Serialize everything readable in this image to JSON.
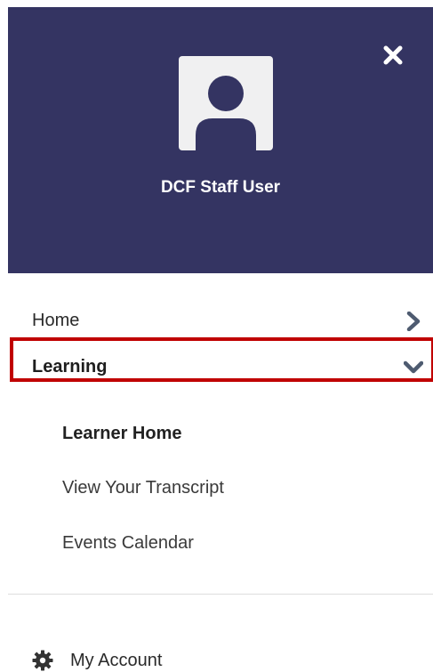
{
  "profile": {
    "user_name": "DCF Staff User",
    "avatar_icon": "user-avatar-icon",
    "close_icon": "close-icon"
  },
  "nav": {
    "home_label": "Home",
    "learning_label": "Learning",
    "learning_expanded": true,
    "learning_submenu": [
      {
        "label": "Learner Home",
        "active": true
      },
      {
        "label": "View Your Transcript",
        "active": false
      },
      {
        "label": "Events Calendar",
        "active": false
      }
    ],
    "account_label": "My Account",
    "account_icon": "gear-icon"
  },
  "colors": {
    "header_bg": "#343462",
    "highlight_border": "#c00000",
    "chevron": "#4e5b70"
  }
}
